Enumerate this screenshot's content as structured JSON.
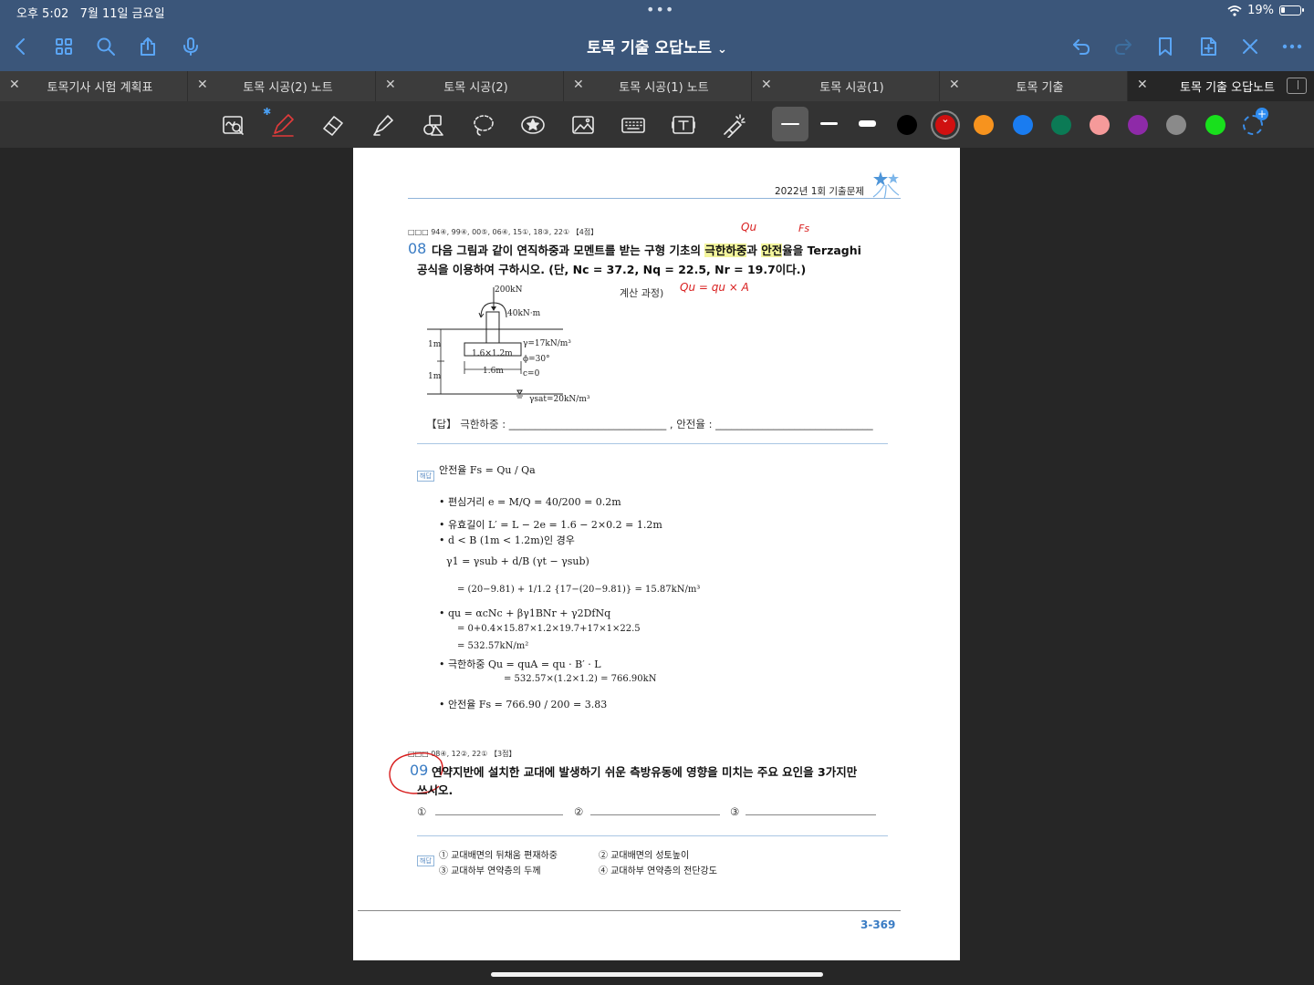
{
  "status_bar": {
    "time": "오후 5:02",
    "date": "7월 11일 금요일",
    "dots": "•••",
    "battery": "19%"
  },
  "nav": {
    "title": "토목 기출 오답노트",
    "title_chevron": "⌄",
    "icons_left": [
      "back-icon",
      "grid-icon",
      "search-icon",
      "share-icon",
      "mic-icon"
    ],
    "icons_right": [
      "undo-icon",
      "redo-icon",
      "bookmark-icon",
      "add-page-icon",
      "close-icon",
      "more-icon"
    ]
  },
  "tabs": [
    {
      "label": "토목기사 시험 계획표",
      "active": false
    },
    {
      "label": "토목 시공(2) 노트",
      "active": false
    },
    {
      "label": "토목 시공(2)",
      "active": false
    },
    {
      "label": "토목 시공(1) 노트",
      "active": false
    },
    {
      "label": "토목 시공(1)",
      "active": false
    },
    {
      "label": "토목 기출",
      "active": false
    },
    {
      "label": "토목 기출 오답노트",
      "active": true
    }
  ],
  "toolbar": {
    "tools": [
      "zoom-lasso-icon",
      "pen-icon",
      "eraser-icon",
      "highlighter-icon",
      "shapes-icon",
      "lasso-icon",
      "sticker-icon",
      "image-icon",
      "keyboard-icon",
      "text-box-icon",
      "laser-pointer-icon"
    ],
    "colors": [
      "#000000",
      "#d01010",
      "#f7931e",
      "#1a7cf0",
      "#0b7a55",
      "#f59a9a",
      "#8e2aa8",
      "#8a8a8a",
      "#18e01c"
    ],
    "selected_color": "#d01010"
  },
  "page": {
    "header_title": "2022년 1회 기출문제",
    "q08": {
      "meta": "□□□ 94④, 99④, 00⑤, 06④, 15①, 18③, 22① 【4점】",
      "number": "08",
      "text_line1_a": "다음 그림과 같이 연직하중과 모멘트를 받는 구형 기초의 ",
      "hl1": "극한하중",
      "text_line1_b": "과 ",
      "hl2": "안전",
      "text_line1_c": "율을 Terzaghi",
      "text_line2": "공식을 이용하여 구하시오. (단, Nc = 37.2, Nq = 22.5, Nr = 19.7이다.)",
      "figure": {
        "load": "200kN",
        "moment": "40kN·m",
        "depth1": "1m",
        "depth2": "1m",
        "footing": "1.6×1.2m",
        "width": "1.6m",
        "gamma": "γ=17kN/m³",
        "phi": "ϕ=30°",
        "c": "c=0",
        "gamma_sat": "γsat=20kN/m³"
      },
      "calc_label": "계산 과정)",
      "answer": "【답】 극한하중 : ______________________________ ,  안전율 : ______________________________"
    },
    "solution": {
      "badge": "해답",
      "lines": [
        "안전율 Fs = Qu / Qa",
        "• 편심거리 e = M/Q = 40/200 = 0.2m",
        "• 유효길이 L′ = L − 2e = 1.6 − 2×0.2 = 1.2m",
        "• d < B (1m < 1.2m)인 경우",
        "γ1 = γsub + d/B (γt − γsub)",
        "= (20−9.81) + 1/1.2 {17−(20−9.81)} = 15.87kN/m³",
        "• qu = αcNc + βγ1BNr + γ2DfNq",
        "= 0+0.4×15.87×1.2×19.7+17×1×22.5",
        "= 532.57kN/m²",
        "• 극한하중 Qu = quA = qu · B′ · L",
        "= 532.57×(1.2×1.2) = 766.90kN",
        "• 안전율 Fs = 766.90 / 200 = 3.83"
      ]
    },
    "q09": {
      "meta": "□□□ 08④, 12②, 22① 【3점】",
      "number": "09",
      "text_line1": "연약지반에 설치한 교대에 발생하기 쉬운 측방유동에 영향을 미치는 주요 요인을 3가지만",
      "text_line2": "쓰시오.",
      "blanks": [
        "①",
        "②",
        "③"
      ],
      "badge": "해답",
      "answers": [
        "① 교대배면의 뒤채움 편재하중",
        "② 교대배면의 성토높이",
        "③ 교대하부 연약층의 두께",
        "④ 교대하부 연약층의 전단강도"
      ]
    },
    "page_number": "3-369",
    "handwriting": {
      "qu_note": "Qu",
      "fs_note": "Fs",
      "formula": "Qu = qu × A"
    }
  }
}
